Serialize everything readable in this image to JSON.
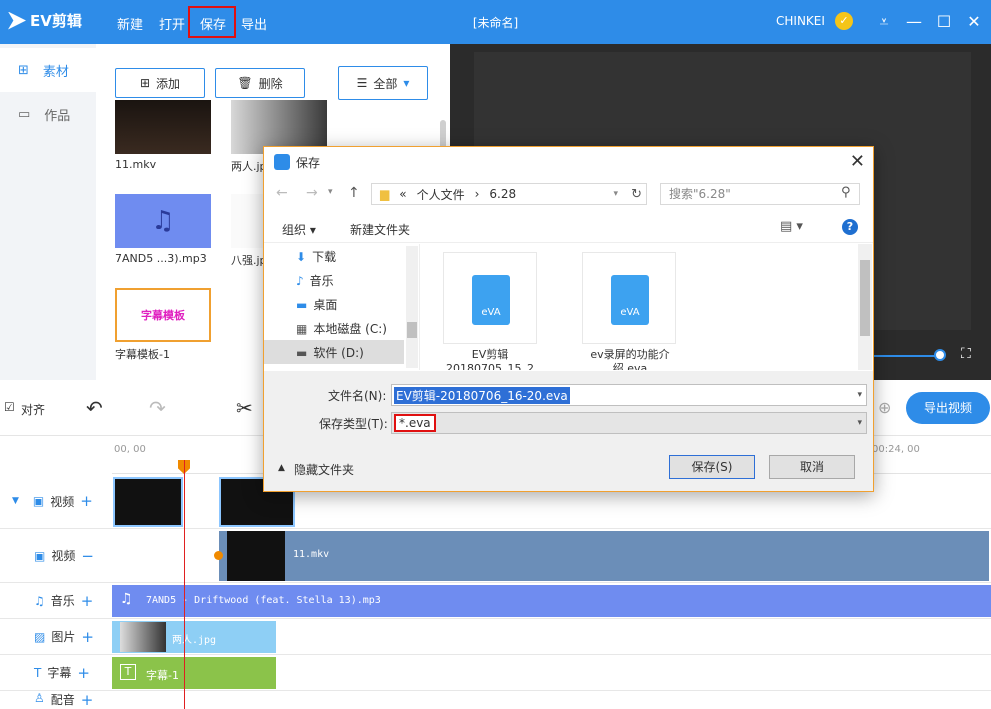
{
  "app": {
    "logo_text": "EV剪辑",
    "menu": [
      "新建",
      "打开",
      "保存",
      "导出"
    ],
    "doc_title": "[未命名]",
    "username": "CHINKEI"
  },
  "left_nav": [
    {
      "label": "素材"
    },
    {
      "label": "作品"
    }
  ],
  "media_panel": {
    "add_label": "添加",
    "delete_label": "删除",
    "filter_label": "全部",
    "items": [
      {
        "name": "11.mkv"
      },
      {
        "name": "两人.jpg"
      },
      {
        "name": "7AND5 ...3).mp3"
      },
      {
        "name": "八强.jpg"
      },
      {
        "name": "字幕模板-1",
        "thumb_text": "字幕模板"
      }
    ]
  },
  "toolbar": {
    "align_label": "对齐",
    "export_label": "导出视频"
  },
  "timeline": {
    "ruler_start": "00, 00",
    "ruler_end": "00:24, 00",
    "tracks": [
      {
        "label": "视频"
      },
      {
        "label": "视频"
      },
      {
        "label": "音乐"
      },
      {
        "label": "图片"
      },
      {
        "label": "字幕"
      },
      {
        "label": "配音"
      }
    ],
    "clips": {
      "video2": "11.mkv",
      "music": "7AND5 - Driftwood (feat. Stella 13).mp3",
      "image": "两人.jpg",
      "subtitle": "字幕-1"
    }
  },
  "dialog": {
    "title": "保存",
    "breadcrumb": [
      "«",
      "个人文件",
      "6.28"
    ],
    "search_placeholder": "搜索\"6.28\"",
    "organize_label": "组织",
    "new_folder_label": "新建文件夹",
    "tree": [
      "下载",
      "音乐",
      "桌面",
      "本地磁盘 (C:)",
      "软件 (D:)"
    ],
    "files": [
      {
        "name": "EV剪辑\n20180705_15_2",
        "icon_label": "eVA"
      },
      {
        "name": "ev录屏的功能介\n绍.eva",
        "icon_label": "eVA"
      }
    ],
    "filename_label": "文件名(N):",
    "filename_value": "EV剪辑-20180706_16-20.eva",
    "filetype_label": "保存类型(T):",
    "filetype_value": "*.eva",
    "hide_folders_label": "隐藏文件夹",
    "save_label": "保存(S)",
    "cancel_label": "取消"
  },
  "colors": {
    "brand": "#2e8ce8",
    "highlight": "#e01010",
    "music_track": "#6f8cf0",
    "image_track": "#8ecff5",
    "subtitle_track": "#8bc34a"
  }
}
